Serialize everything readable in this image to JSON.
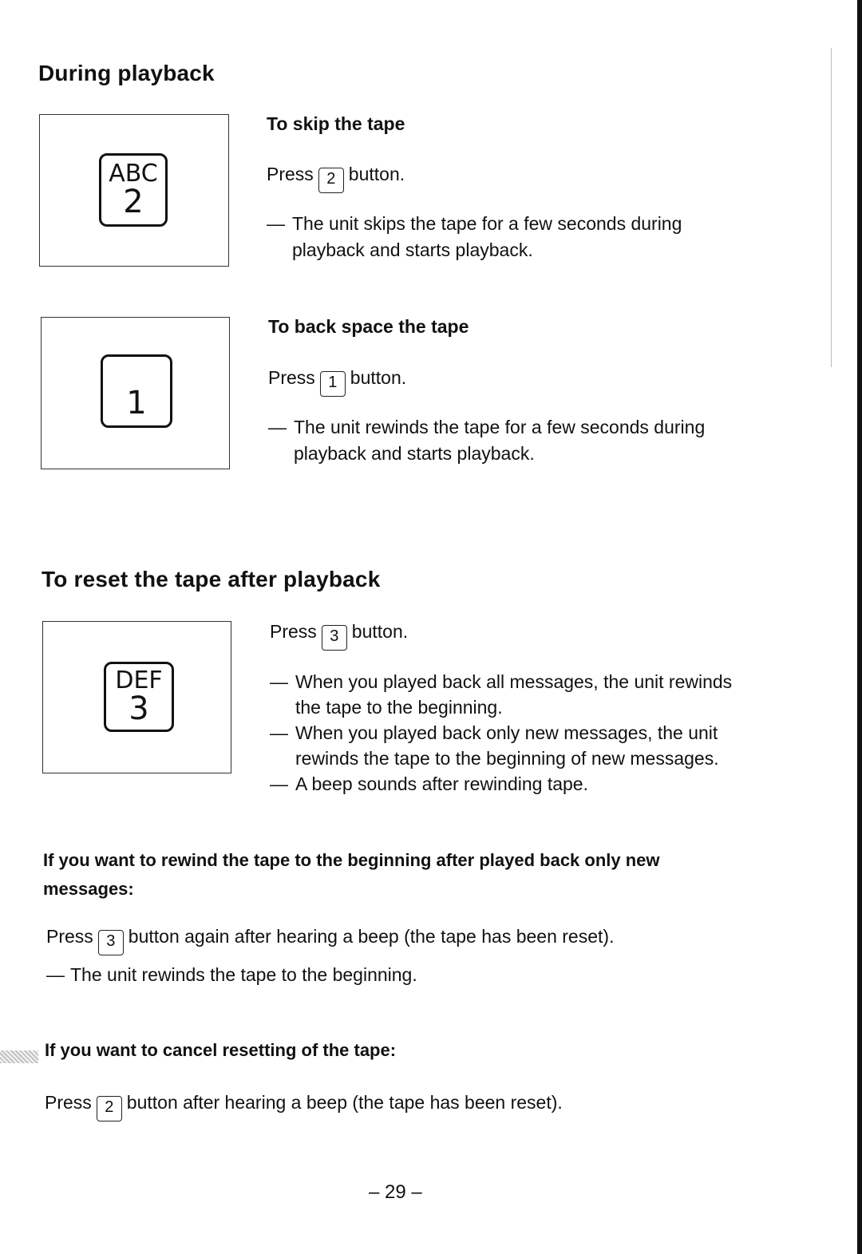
{
  "page": {
    "page_number": "– 29 –"
  },
  "during_playback": {
    "title": "During playback",
    "skip": {
      "heading": "To skip the tape",
      "key_label_sub": "ABC",
      "key_label_num": "2",
      "press_prefix": "Press",
      "press_key": "2",
      "press_suffix": "button.",
      "bullets": [
        {
          "dash": "—",
          "text": "The unit skips the tape for a few seconds during playback and starts playback."
        }
      ]
    },
    "backspace": {
      "heading": "To back space the tape",
      "key_label_num": "1",
      "press_prefix": "Press",
      "press_key": "1",
      "press_suffix": "button.",
      "bullets": [
        {
          "dash": "—",
          "text": "The unit rewinds the tape for a few seconds during playback and starts playback."
        }
      ]
    }
  },
  "reset": {
    "title": "To reset the tape after playback",
    "key_label_sub": "DEF",
    "key_label_num": "3",
    "press_prefix": "Press",
    "press_key": "3",
    "press_suffix": "button.",
    "bullets": [
      {
        "dash": "—",
        "text": "When you played back all messages, the unit rewinds the tape to the beginning."
      },
      {
        "dash": "—",
        "text": "When you played back only new messages, the unit rewinds the tape to the beginning of new messages."
      },
      {
        "dash": "—",
        "text": "A beep sounds after rewinding tape."
      }
    ]
  },
  "rewind_to_beginning": {
    "heading": "If you want to rewind the tape to the beginning after played back only new messages:",
    "press_prefix": "Press",
    "press_key": "3",
    "press_suffix": "button again after hearing a beep (the tape has been reset).",
    "bullets": [
      {
        "dash": "—",
        "text": "The unit rewinds the tape to the beginning."
      }
    ]
  },
  "cancel_reset": {
    "heading": "If you want to cancel resetting of the tape:",
    "press_prefix": "Press",
    "press_key": "2",
    "press_suffix": "button after hearing a beep (the tape has been reset)."
  }
}
